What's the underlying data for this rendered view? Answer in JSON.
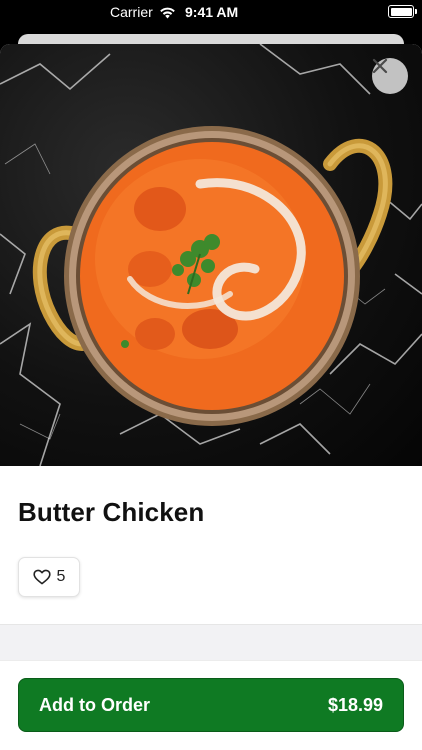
{
  "status_bar": {
    "carrier": "Carrier",
    "time": "9:41 AM",
    "icons": [
      "wifi-icon",
      "battery-icon"
    ]
  },
  "item": {
    "name": "Butter Chicken",
    "image_alt_icon": "food-photo",
    "likes": "5",
    "like_icon": "heart-outline-icon"
  },
  "actions": {
    "close_icon": "close-icon",
    "add_label": "Add to Order",
    "price": "$18.99"
  },
  "colors": {
    "primary_button": "#0f7a23",
    "curry": "#f06a1e",
    "brass": "#c99a3a"
  }
}
